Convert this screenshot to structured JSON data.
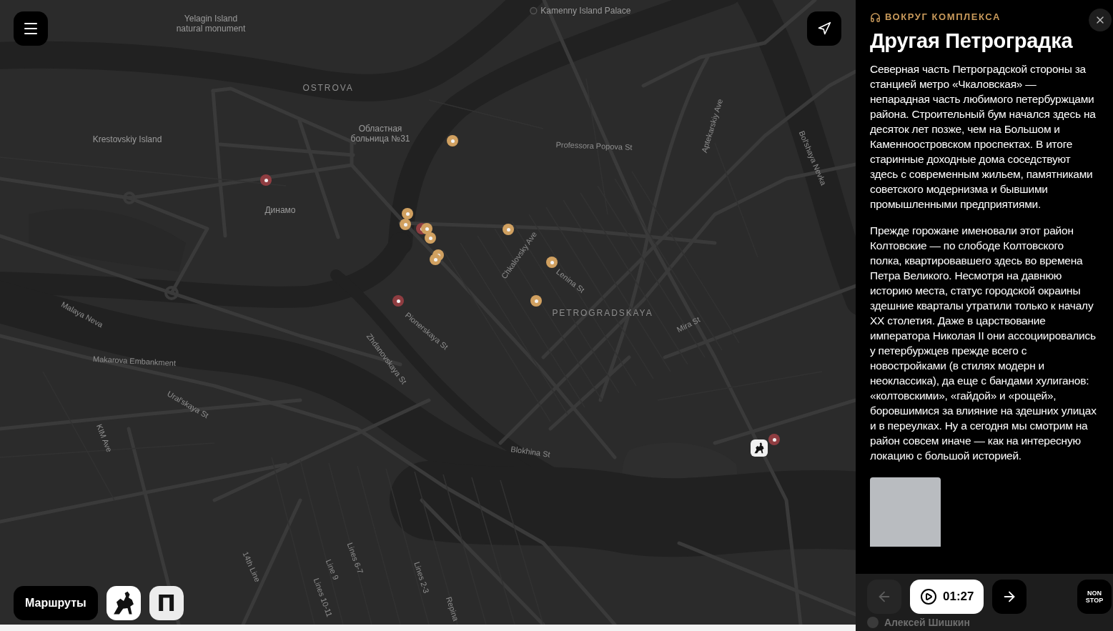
{
  "map": {
    "labels": [
      {
        "kind": "place",
        "text": "Yelagin Island natural monument"
      },
      {
        "kind": "poi",
        "text": "Kamenny Island Palace"
      },
      {
        "kind": "district",
        "text": "OSTROVA"
      },
      {
        "kind": "place",
        "text": "Krestovskiy Island"
      },
      {
        "kind": "place",
        "text": "Областная больница №31"
      },
      {
        "kind": "street",
        "text": "Professora Popova St"
      },
      {
        "kind": "street",
        "text": "Aptekarskiy Ave"
      },
      {
        "kind": "street",
        "text": "Bol'shaya Nevka"
      },
      {
        "kind": "place",
        "text": "Динамо"
      },
      {
        "kind": "street",
        "text": "Chkalovsky Ave"
      },
      {
        "kind": "street",
        "text": "Lenina St"
      },
      {
        "kind": "district",
        "text": "PETROGRADSKAYA"
      },
      {
        "kind": "street",
        "text": "Malaya Neva"
      },
      {
        "kind": "street",
        "text": "Pionerskaya St"
      },
      {
        "kind": "street",
        "text": "Mira St"
      },
      {
        "kind": "street",
        "text": "Zhdanovskaya St"
      },
      {
        "kind": "street",
        "text": "Makarova Embankment"
      },
      {
        "kind": "street",
        "text": "Ural'skaya St"
      },
      {
        "kind": "street",
        "text": "KIM Ave"
      },
      {
        "kind": "street",
        "text": "Blokhina St"
      },
      {
        "kind": "street",
        "text": "14th Line"
      },
      {
        "kind": "street",
        "text": "Line 9"
      },
      {
        "kind": "street",
        "text": "Lines 6-7"
      },
      {
        "kind": "street",
        "text": "Lines 10-11"
      },
      {
        "kind": "street",
        "text": "Lines 2-3"
      },
      {
        "kind": "street",
        "text": "Repina"
      }
    ],
    "markers": [
      {
        "color": "#d0a060"
      },
      {
        "color": "#8f3d41"
      },
      {
        "color": "#d0a060"
      },
      {
        "color": "#d0a060"
      },
      {
        "color": "#8f3d41"
      },
      {
        "color": "#d0a060"
      },
      {
        "color": "#d0a060"
      },
      {
        "color": "#d0a060"
      },
      {
        "color": "#d0a060"
      },
      {
        "color": "#d0a060"
      },
      {
        "color": "#d0a060"
      },
      {
        "color": "#8f3d41"
      },
      {
        "color": "#d0a060"
      },
      {
        "color": "#8f3d41"
      }
    ]
  },
  "routes_button": "Маршруты",
  "logo_button": "П",
  "panel": {
    "category": "ВОКРУГ КОМПЛЕКСА",
    "title": "Другая Петроградка",
    "paragraphs": [
      "Северная часть Петроградской стороны за станцией метро «Чкаловская» — непарадная часть любимого петербуржцами района. Строительный бум начался здесь на десяток лет позже, чем на Большом и Каменноостровском проспектах. В итоге старинные доходные дома соседствуют здесь с современным жильем, памятниками советского модернизма и бывшими промышленными предприятиями.",
      "Прежде горожане именовали этот район Колтовские — по слободе Колтовского полка, квартировавшего здесь во времена Петра Великого. Несмотря на давнюю историю места, статус городской окраины здешние кварталы утратили только к началу XX столетия. Даже в царствование императора Николая II они ассоциировались у петербуржцев прежде всего с новостройками (в стилях модерн и неоклассика), да еще с бандами хулиганов: «колтовскими», «гайдой» и «рощей», боровшимися за влияние на здешних улицах и в переулках. Ну а сегодня мы смотрим на район совсем иначе — как на интересную локацию с большой историей."
    ],
    "player": {
      "back": {
        "disabled": true
      },
      "playing": false,
      "time": "01:27",
      "next": {
        "disabled": false
      },
      "nonstop_label": "NON STOP"
    },
    "author": "Алексей Шишкин"
  }
}
